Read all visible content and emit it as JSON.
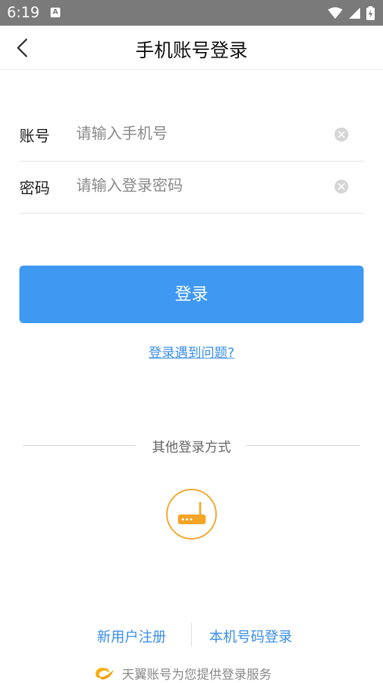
{
  "status_bar": {
    "time": "6:19",
    "notification_glyph": "A"
  },
  "header": {
    "title": "手机账号登录"
  },
  "form": {
    "account": {
      "label": "账号",
      "placeholder": "请输入手机号",
      "value": ""
    },
    "password": {
      "label": "密码",
      "placeholder": "请输入登录密码",
      "value": ""
    }
  },
  "login_button": "登录",
  "problem_link": "登录遇到问题?",
  "other_login": {
    "title": "其他登录方式",
    "icon": "router-icon"
  },
  "bottom_links": {
    "register": "新用户注册",
    "local_number_login": "本机号码登录"
  },
  "footer": {
    "text": "天翼账号为您提供登录服务"
  },
  "colors": {
    "primary": "#3f99f2",
    "link": "#3a8ee6",
    "router_accent": "#f3a425",
    "status_bar": "#7a7a7a"
  }
}
